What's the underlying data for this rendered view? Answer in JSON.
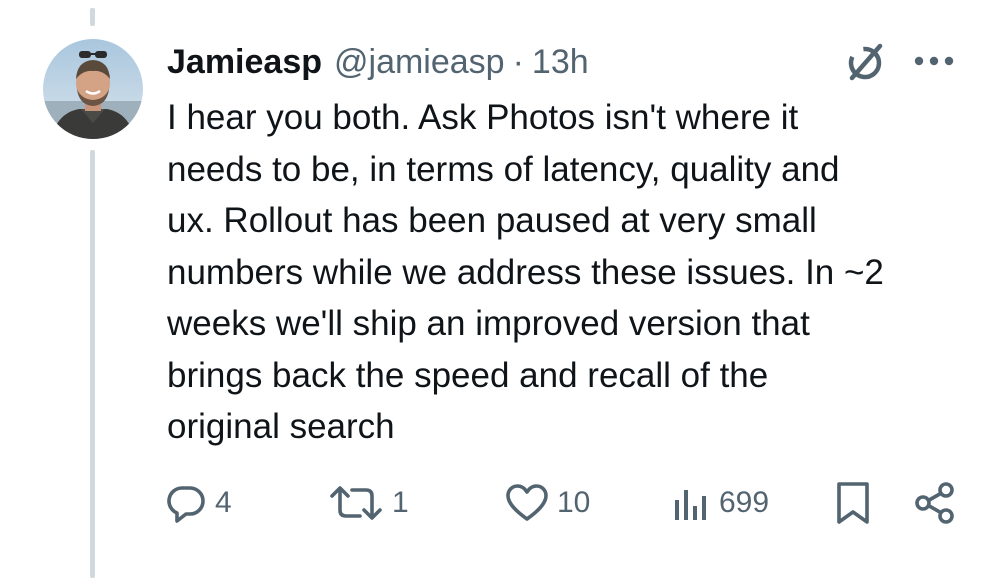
{
  "tweet": {
    "author": {
      "display_name": "Jamieasp",
      "handle": "@jamieasp"
    },
    "separator": "·",
    "time": "13h",
    "text_lines": [
      "I hear you both. Ask Photos isn't where it",
      "needs to be, in terms of latency, quality and",
      "ux. Rollout has been paused at very small",
      "numbers while we address these issues. In ~2",
      "weeks we'll ship an improved version that",
      "brings back the speed and recall of the",
      "original search"
    ]
  },
  "actions": {
    "replies": "4",
    "reposts": "1",
    "likes": "10",
    "views": "699"
  },
  "icons": {
    "grok": "grok-icon",
    "more": "more-dots-icon",
    "reply": "reply-icon",
    "repost": "repost-icon",
    "like": "heart-icon",
    "views": "views-bar-chart-icon",
    "bookmark": "bookmark-icon",
    "share": "share-icon"
  },
  "colors": {
    "text": "#0f1419",
    "muted": "#536471",
    "thread_line": "#cfd9de",
    "background": "#ffffff"
  }
}
